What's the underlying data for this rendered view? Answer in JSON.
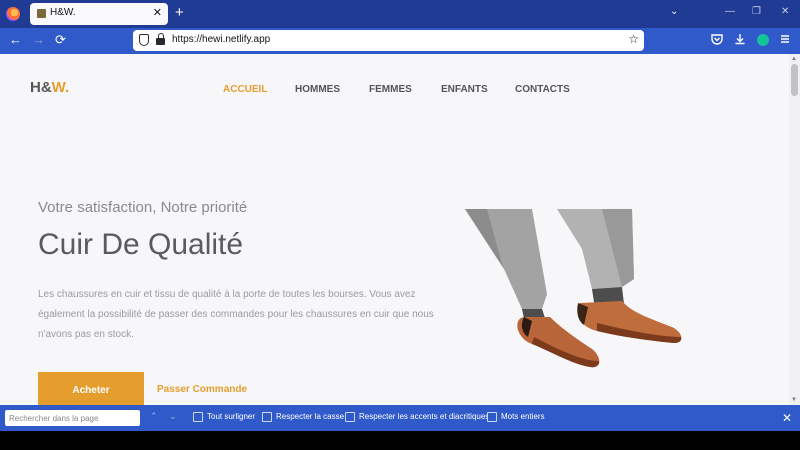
{
  "browser": {
    "tab_title": "H&W.",
    "tab_close": "✕",
    "new_tab": "+",
    "url": "https://hewi.netlify.app",
    "back": "←",
    "forward": "→",
    "reload": "⟳",
    "tabs_menu": "⌄",
    "minimize": "—",
    "restore": "❐",
    "close": "✕",
    "bookmark_star": "☆"
  },
  "site": {
    "logo_prefix": "H&",
    "logo_w": "W",
    "logo_dot": ".",
    "nav": [
      "ACCUEIL",
      "HOMMES",
      "FEMMES",
      "ENFANTS",
      "CONTACTS"
    ],
    "active_nav": "ACCUEIL",
    "subtitle": "Votre satisfaction, Notre priorité",
    "headline": "Cuir De Qualité",
    "description": "Les chaussures en cuir et tissu de qualité à la porte de toutes les bourses. Vous avez également la possibilité de passer des commandes pour les chaussures en cuir que nous n'avons pas en stock.",
    "buy_button": "Acheter",
    "order_button": "Passer Commande",
    "accent_color": "#e59e2e"
  },
  "findbar": {
    "placeholder": "Rechercher dans la page",
    "up": "⌃",
    "down": "⌄",
    "options": [
      "Tout surligner",
      "Respecter la casse",
      "Respecter les accents et diacritiques",
      "Mots entiers"
    ],
    "close": "✕"
  },
  "icons": [
    "firefox-logo-icon",
    "shield-icon",
    "lock-icon",
    "star-icon",
    "pocket-icon",
    "download-icon",
    "grammarly-icon",
    "menu-icon"
  ]
}
